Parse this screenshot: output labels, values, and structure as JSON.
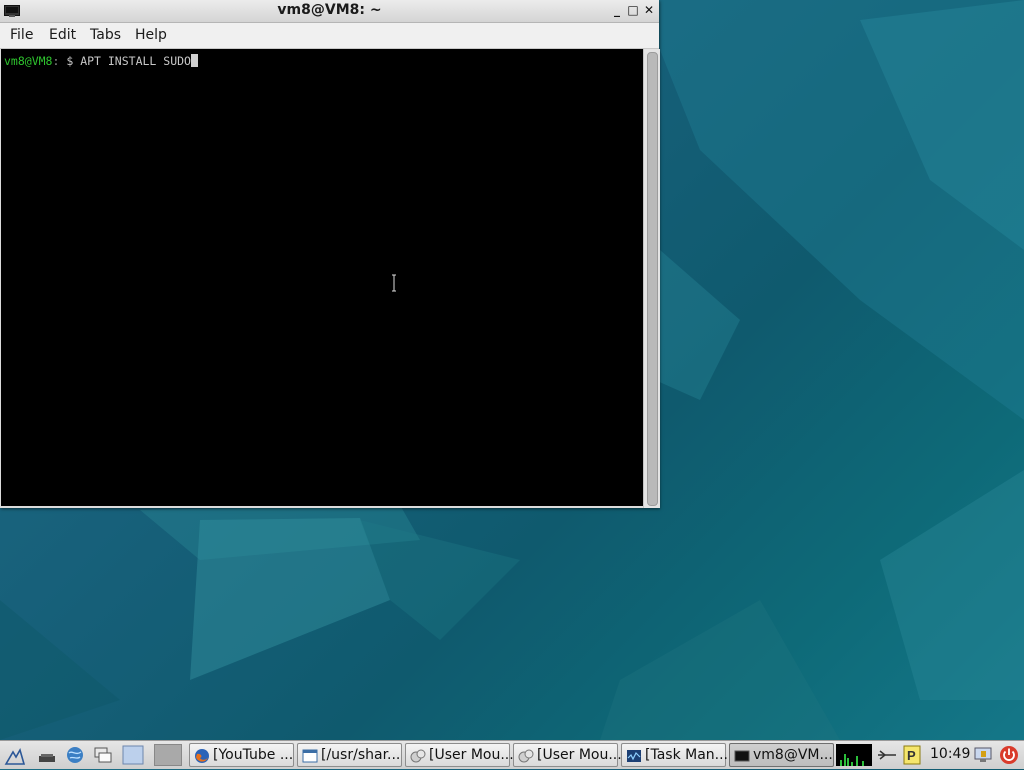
{
  "window": {
    "title": "vm8@VM8: ~",
    "controls": {
      "minimize": "_",
      "maximize": "□",
      "close": "✕"
    }
  },
  "menu": {
    "items": [
      "File",
      "Edit",
      "Tabs",
      "Help"
    ]
  },
  "terminal": {
    "prompt_user": "vm8@VM8",
    "prompt_sep": ":",
    "prompt_dir": " $ ",
    "command": "APT INSTALL SUDO"
  },
  "taskbar": {
    "launchers": [
      "start-menu-icon",
      "folder-icon",
      "globe-icon",
      "windows-icon",
      "desktop-icon"
    ],
    "tasks": [
      {
        "label": "[YouTube ...",
        "icon": "firefox-icon"
      },
      {
        "label": "[/usr/shar...",
        "icon": "file-manager-icon"
      },
      {
        "label": "[User Mou...",
        "icon": "user-mount-icon"
      },
      {
        "label": "[User Mou...",
        "icon": "user-mount-icon"
      },
      {
        "label": "[Task Man...",
        "icon": "task-manager-icon"
      },
      {
        "label": "vm8@VM...",
        "icon": "terminal-icon"
      }
    ],
    "clock": "10:49"
  },
  "colors": {
    "terminal_bg": "#000000",
    "prompt_user": "#2ec42e",
    "desktop": "#17607a"
  }
}
